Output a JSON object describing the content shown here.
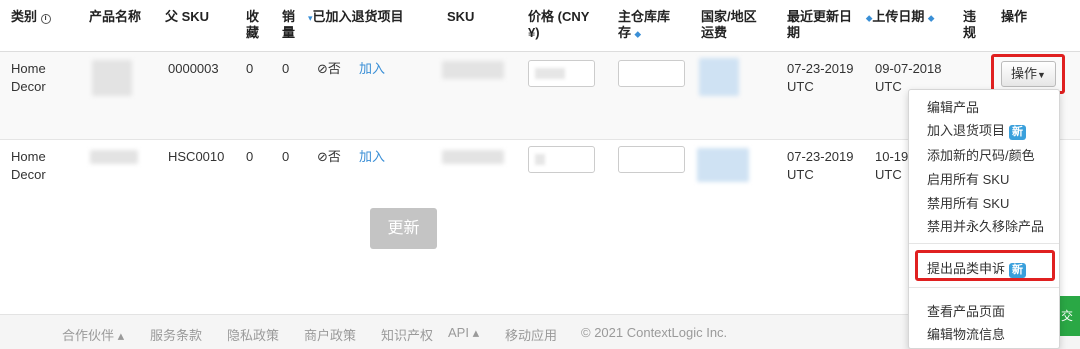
{
  "table": {
    "headers": {
      "category": "类别",
      "product_name": "产品名称",
      "parent_sku": "父 SKU",
      "favorites_1": "收",
      "favorites_2": "藏",
      "sales_1": "销",
      "sales_2": "量",
      "return_project": "已加入退货项目",
      "sku": "SKU",
      "price_1": "价格 (CNY",
      "price_2": "¥)",
      "warehouse_1": "主仓库库",
      "warehouse_2": "存",
      "country_1": "国家/地区",
      "country_2": "运费",
      "last_update_1": "最近更新日",
      "last_update_2": "期",
      "upload_date": "上传日期",
      "violation_1": "违",
      "violation_2": "规",
      "actions": "操作"
    },
    "rows": [
      {
        "category_1": "Home",
        "category_2": "Decor",
        "parent_sku": "0000003",
        "favorites": "0",
        "sales": "0",
        "return_status": "否",
        "join_link": "加入",
        "last_update_1": "07-23-2019",
        "last_update_2": "UTC",
        "upload_1": "09-07-2018",
        "upload_2": "UTC"
      },
      {
        "category_1": "Home",
        "category_2": "Decor",
        "parent_sku": "HSC0010",
        "favorites": "0",
        "sales": "0",
        "return_status": "否",
        "join_link": "加入",
        "last_update_1": "07-23-2019",
        "last_update_2": "UTC",
        "upload_1": "10-19",
        "upload_2": "UTC"
      }
    ]
  },
  "action_button": "操作",
  "update_button": "更新",
  "dropdown": {
    "group1": [
      "编辑产品",
      "加入退货项目",
      "添加新的尺码/颜色",
      "启用所有 SKU",
      "禁用所有 SKU",
      "禁用并永久移除产品"
    ],
    "appeal": "提出品类申诉",
    "group3": [
      "查看产品页面",
      "编辑物流信息"
    ],
    "new_badge": "新"
  },
  "footer": {
    "partners": "合作伙伴",
    "terms": "服务条款",
    "privacy": "隐私政策",
    "merchant_policy": "商户政策",
    "ip": "知识产权",
    "api": "API",
    "mobile": "移动应用",
    "copyright": "© 2021 ContextLogic Inc."
  },
  "chat_tab": "交谈",
  "colors": {
    "link": "#3a8fd6",
    "highlight": "#e02020",
    "badge": "#3aa0dc",
    "chat": "#2aa845"
  }
}
